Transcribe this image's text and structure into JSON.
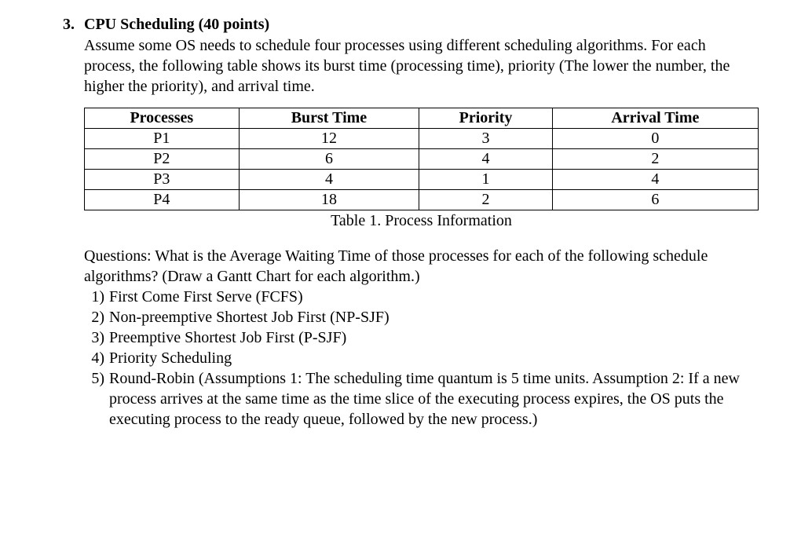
{
  "question": {
    "number": "3.",
    "title": "CPU Scheduling",
    "points": "(40 points)",
    "intro": "Assume some OS needs to schedule four processes using different scheduling algorithms. For each process, the following table shows its burst time (processing time), priority (The lower the number, the higher the priority), and arrival time."
  },
  "table": {
    "headers": [
      "Processes",
      "Burst Time",
      "Priority",
      "Arrival Time"
    ],
    "rows": [
      {
        "process": "P1",
        "burst": "12",
        "priority": "3",
        "arrival": "0"
      },
      {
        "process": "P2",
        "burst": "6",
        "priority": "4",
        "arrival": "2"
      },
      {
        "process": "P3",
        "burst": "4",
        "priority": "1",
        "arrival": "4"
      },
      {
        "process": "P4",
        "burst": "18",
        "priority": "2",
        "arrival": "6"
      }
    ],
    "caption": "Table 1. Process Information"
  },
  "questions": {
    "intro": "Questions: What is the Average Waiting Time of those processes for each of the following schedule algorithms? (Draw a Gantt Chart for each algorithm.)",
    "items": [
      "First Come First Serve (FCFS)",
      "Non-preemptive Shortest Job First (NP-SJF)",
      "Preemptive Shortest Job First (P-SJF)",
      "Priority Scheduling",
      "Round-Robin (Assumptions 1: The scheduling time quantum is 5 time units. Assumption 2: If a new process arrives at the same time as the time slice of the executing process expires, the OS puts the executing process to the ready queue, followed by the new process.)"
    ]
  }
}
